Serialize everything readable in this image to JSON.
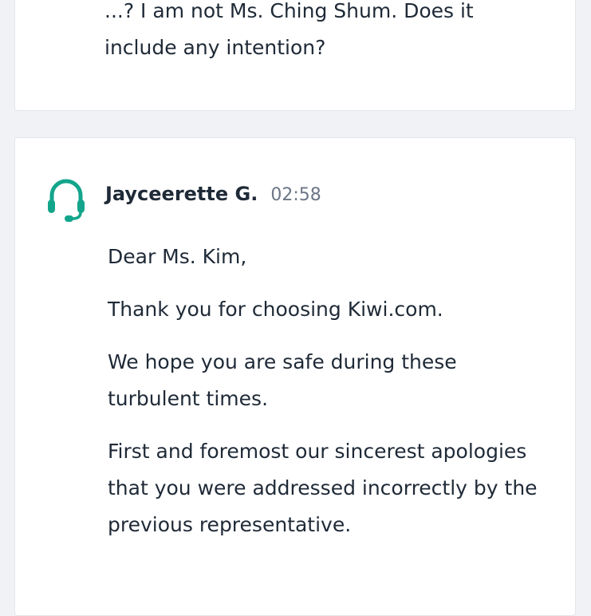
{
  "previous_message": {
    "text": "...? I am not Ms. Ching Shum. Does it include any intention?"
  },
  "reply": {
    "sender": "Jayceerette G.",
    "time": "02:58",
    "avatar_icon": "headset-icon",
    "avatar_color": "#12a58c",
    "paragraphs": [
      "Dear Ms. Kim,",
      "Thank you for choosing Kiwi.com.",
      "We hope you are safe during these turbulent times.",
      "First and foremost our sincerest apologies that you were addressed incorrectly by the previous representative."
    ]
  }
}
